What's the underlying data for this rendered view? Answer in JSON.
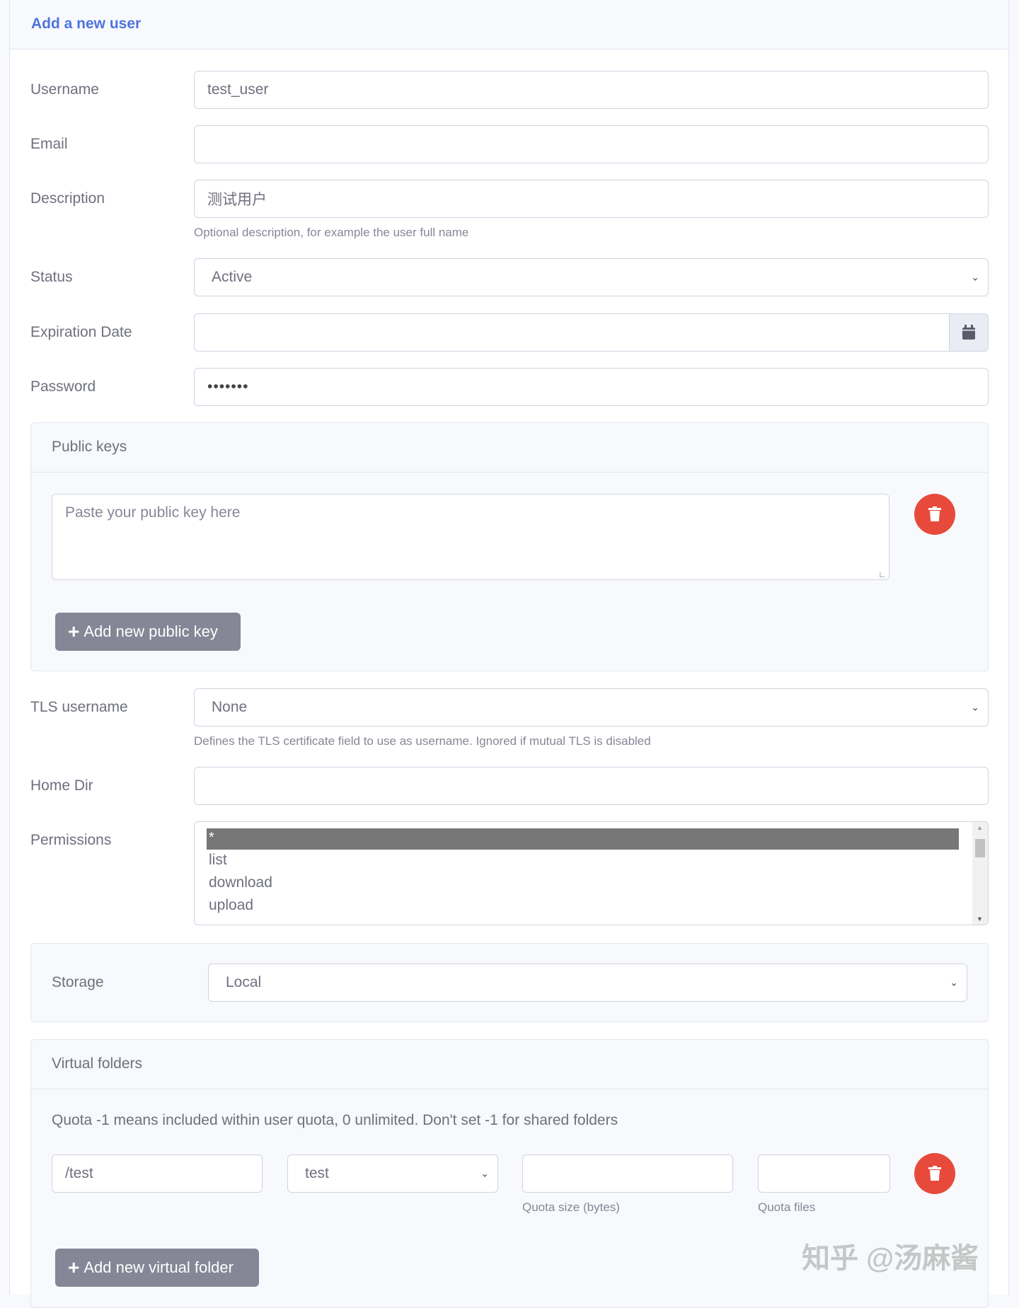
{
  "header": {
    "title": "Add a new user"
  },
  "fields": {
    "username": {
      "label": "Username",
      "value": "test_user"
    },
    "email": {
      "label": "Email",
      "value": ""
    },
    "description": {
      "label": "Description",
      "value": "测试用户",
      "help": "Optional description, for example the user full name"
    },
    "status": {
      "label": "Status",
      "value": "Active"
    },
    "expiration": {
      "label": "Expiration Date",
      "value": ""
    },
    "password": {
      "label": "Password",
      "value": "•••••••"
    },
    "tls_username": {
      "label": "TLS username",
      "value": "None",
      "help": "Defines the TLS certificate field to use as username. Ignored if mutual TLS is disabled"
    },
    "home_dir": {
      "label": "Home Dir",
      "value": ""
    },
    "permissions": {
      "label": "Permissions",
      "options": [
        "*",
        "list",
        "download",
        "upload"
      ],
      "selected": "*"
    }
  },
  "public_keys": {
    "title": "Public keys",
    "placeholder": "Paste your public key here",
    "add_label": "Add new public key"
  },
  "storage": {
    "label": "Storage",
    "value": "Local"
  },
  "virtual_folders": {
    "title": "Virtual folders",
    "note": "Quota -1 means included within user quota, 0 unlimited. Don't set -1 for shared folders",
    "path": "/test",
    "folder": "test",
    "quota_size": "",
    "quota_files": "",
    "quota_size_label": "Quota size (bytes)",
    "quota_files_label": "Quota files",
    "add_label": "Add new virtual folder"
  },
  "watermark": "知乎 @汤麻酱"
}
